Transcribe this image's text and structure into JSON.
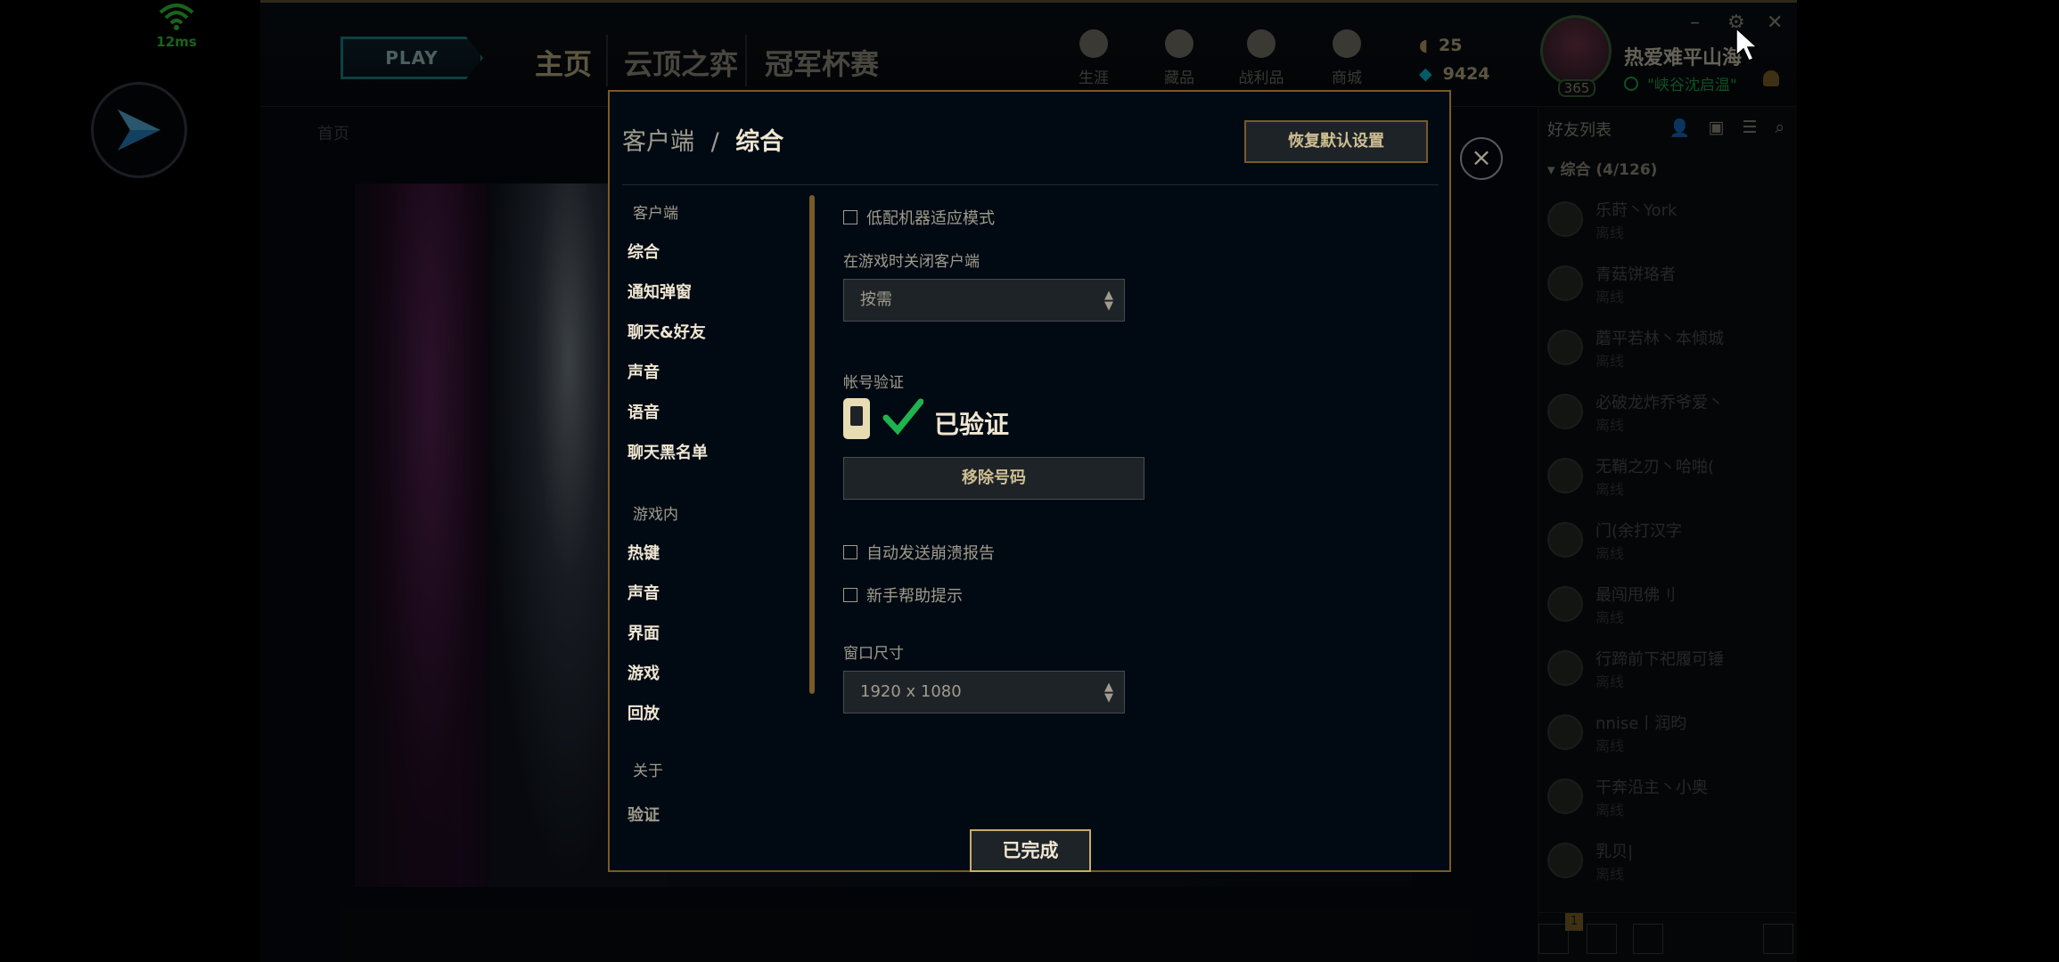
{
  "overlay": {
    "ping": "12ms"
  },
  "client": {
    "play_label": "PLAY",
    "nav_tabs": [
      {
        "label": "主页"
      },
      {
        "label": "云顶之弈"
      },
      {
        "label": "冠军杯赛"
      }
    ],
    "top_icons": [
      {
        "icon": "profile-icon",
        "label": "生涯"
      },
      {
        "icon": "collection-icon",
        "label": "藏品"
      },
      {
        "icon": "loot-icon",
        "label": "战利品"
      },
      {
        "icon": "store-icon",
        "label": "商城"
      }
    ],
    "currency": {
      "rp": "25",
      "be": "9424"
    },
    "user": {
      "name": "热爱难平山海",
      "level": "365",
      "status": "\"峡谷沈启温\""
    },
    "subnav": "首页"
  },
  "friends": {
    "title": "好友列表",
    "group": "综合 (4/126)",
    "list": [
      {
        "name": "乐莳丶York",
        "status": "离线"
      },
      {
        "name": "青菇饼珞者",
        "status": "离线"
      },
      {
        "name": "蘑平若林丶本倾城",
        "status": "离线"
      },
      {
        "name": "必破龙炸乔爷爱丶",
        "status": "离线"
      },
      {
        "name": "无鞘之刃丶哈啪(",
        "status": "离线"
      },
      {
        "name": "门(余打汉字",
        "status": "离线"
      },
      {
        "name": "最闯甩佛刂",
        "status": "离线"
      },
      {
        "name": "行蹄前下祀履可锤",
        "status": "离线"
      },
      {
        "name": "nnise丨润昀",
        "status": "离线"
      },
      {
        "name": "干奔沿主丶小奥",
        "status": "离线"
      },
      {
        "name": "乳贝|",
        "status": "离线"
      }
    ],
    "badge_count": "1"
  },
  "modal": {
    "breadcrumb_parent": "客户端",
    "breadcrumb_sep": "/",
    "breadcrumb_current": "综合",
    "reset_label": "恢复默认设置",
    "close_icon": "close-icon",
    "sidebar": {
      "client_header": "客户端",
      "client_items": [
        "综合",
        "通知弹窗",
        "聊天&好友",
        "声音",
        "语音",
        "聊天黑名单"
      ],
      "ingame_header": "游戏内",
      "ingame_items": [
        "热键",
        "声音",
        "界面",
        "游戏",
        "回放"
      ],
      "about_header": "关于",
      "about_items": [
        "验证"
      ]
    },
    "settings": {
      "low_spec_label": "低配机器适应模式",
      "close_client_label": "在游戏时关闭客户端",
      "close_client_value": "按需",
      "account_verify_label": "帐号验证",
      "verified_text": "已验证",
      "remove_number_label": "移除号码",
      "auto_crash_report_label": "自动发送崩溃报告",
      "newbie_tips_label": "新手帮助提示",
      "window_size_label": "窗口尺寸",
      "window_size_value": "1920 x 1080"
    },
    "done_label": "已完成"
  }
}
